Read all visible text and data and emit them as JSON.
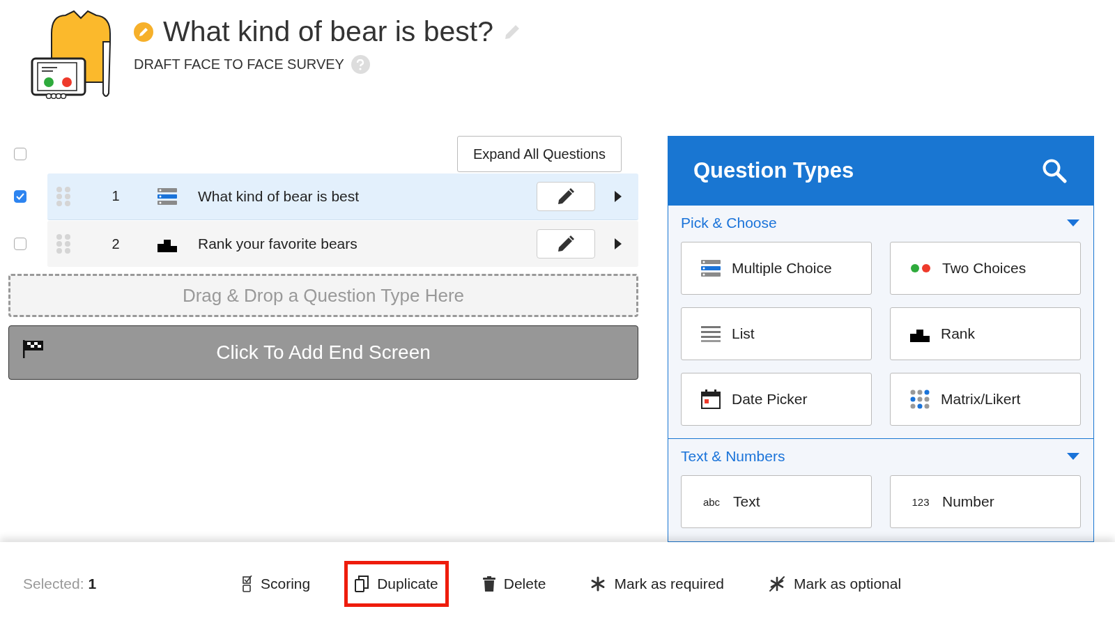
{
  "header": {
    "title": "What kind of bear is best?",
    "subtitle": "DRAFT FACE TO FACE SURVEY"
  },
  "select_all": {
    "checked": false
  },
  "expand_button": "Expand All Questions",
  "questions": [
    {
      "number": "1",
      "kind": "multiple-choice",
      "text": "What kind of bear is best",
      "checked": true
    },
    {
      "number": "2",
      "kind": "rank",
      "text": "Rank your favorite bears",
      "checked": false
    }
  ],
  "drop_zone": "Drag & Drop a Question Type Here",
  "end_screen": "Click To Add End Screen",
  "panel": {
    "title": "Question Types",
    "sections": [
      {
        "title": "Pick & Choose",
        "expanded": true,
        "types": [
          {
            "kind": "multiple-choice",
            "label": "Multiple Choice"
          },
          {
            "kind": "two-choices",
            "label": "Two Choices"
          },
          {
            "kind": "list",
            "label": "List"
          },
          {
            "kind": "rank",
            "label": "Rank"
          },
          {
            "kind": "date",
            "label": "Date Picker"
          },
          {
            "kind": "matrix",
            "label": "Matrix/Likert"
          }
        ]
      },
      {
        "title": "Text & Numbers",
        "expanded": true,
        "types": [
          {
            "kind": "text",
            "icon_text": "abc",
            "label": "Text"
          },
          {
            "kind": "number",
            "icon_text": "123",
            "label": "Number"
          }
        ]
      }
    ]
  },
  "bottom_bar": {
    "selected_label": "Selected:",
    "selected_count": "1",
    "actions": [
      {
        "kind": "scoring",
        "label": "Scoring",
        "highlighted": false
      },
      {
        "kind": "duplicate",
        "label": "Duplicate",
        "highlighted": true
      },
      {
        "kind": "delete",
        "label": "Delete",
        "highlighted": false
      },
      {
        "kind": "required",
        "label": "Mark as required",
        "highlighted": false
      },
      {
        "kind": "optional",
        "label": "Mark as optional",
        "highlighted": false
      }
    ]
  }
}
